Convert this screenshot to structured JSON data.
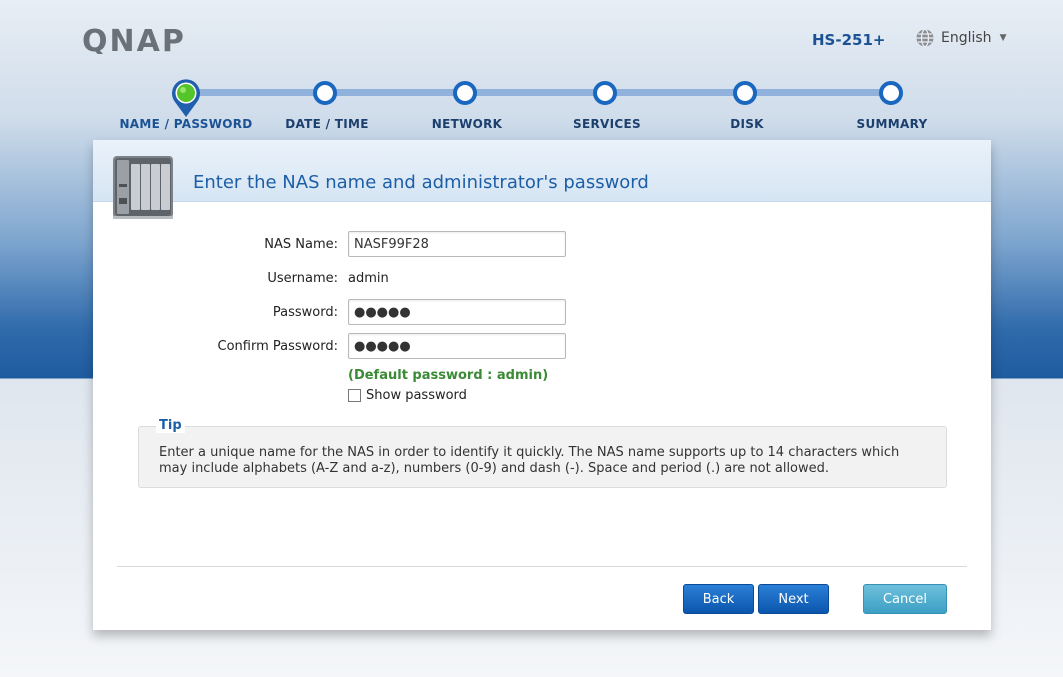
{
  "header": {
    "logo_text": "QNAP",
    "model": "HS-251+",
    "language": "English",
    "globe_icon": "globe-icon",
    "caret_icon": "caret-down-icon"
  },
  "steps": [
    {
      "label": "NAME / PASSWORD",
      "active": true
    },
    {
      "label": "DATE / TIME",
      "active": false
    },
    {
      "label": "NETWORK",
      "active": false
    },
    {
      "label": "SERVICES",
      "active": false
    },
    {
      "label": "DISK",
      "active": false
    },
    {
      "label": "SUMMARY",
      "active": false
    }
  ],
  "panel": {
    "title": "Enter the NAS name and administrator's password",
    "icon": "nas-device-icon"
  },
  "form": {
    "nas_name_label": "NAS Name:",
    "nas_name_value": "NASF99F28",
    "username_label": "Username:",
    "username_value": "admin",
    "password_label": "Password:",
    "password_value": "●●●●●",
    "confirm_label": "Confirm Password:",
    "confirm_value": "●●●●●",
    "default_hint": "(Default password : admin)",
    "show_password_label": "Show password",
    "show_password_checked": false
  },
  "tip": {
    "title": "Tip",
    "text": "Enter a unique name for the NAS in order to identify it quickly. The NAS name supports up to 14 characters which may include alphabets (A-Z and a-z), numbers (0-9) and dash (-). Space and period (.) are not allowed."
  },
  "buttons": {
    "back": "Back",
    "next": "Next",
    "cancel": "Cancel"
  },
  "colors": {
    "accent": "#1a67bf",
    "active_step": "#55c42a",
    "hint_green": "#3a8a36"
  }
}
